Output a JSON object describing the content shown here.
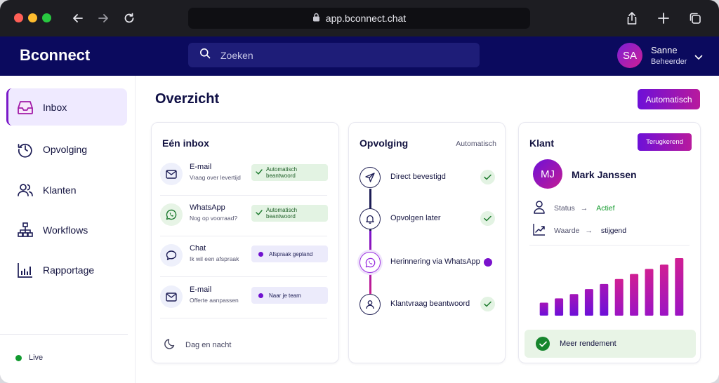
{
  "browser": {
    "url": "app.bconnect.chat"
  },
  "app": {
    "brand": "Bconnect",
    "search_placeholder": "Zoeken",
    "user": {
      "initials": "SA",
      "name": "Sanne",
      "role": "Beheerder"
    }
  },
  "sidebar": {
    "items": [
      {
        "label": "Inbox",
        "icon": "inbox-icon",
        "active": true
      },
      {
        "label": "Opvolging",
        "icon": "clock-icon",
        "active": false
      },
      {
        "label": "Klanten",
        "icon": "users-icon",
        "active": false
      },
      {
        "label": "Workflows",
        "icon": "workflow-icon",
        "active": false
      },
      {
        "label": "Rapportage",
        "icon": "bar-chart-icon",
        "active": false
      }
    ],
    "status": "Live"
  },
  "main": {
    "title": "Overzicht",
    "auto_button": "Automatisch"
  },
  "inbox_card": {
    "title": "Eén inbox",
    "rows": [
      {
        "channel": "E-mail",
        "message": "Vraag over levertijd",
        "status": "Automatisch beantwoord",
        "status_type": "green",
        "icon": "mail-icon"
      },
      {
        "channel": "WhatsApp",
        "message": "Nog op voorraad?",
        "status": "Automatisch beantwoord",
        "status_type": "green",
        "icon": "whatsapp-icon"
      },
      {
        "channel": "Chat",
        "message": "Ik wil een afspraak",
        "status": "Afspraak gepland",
        "status_type": "purple",
        "icon": "chat-icon"
      },
      {
        "channel": "E-mail",
        "message": "Offerte aanpassen",
        "status": "Naar je team",
        "status_type": "purple",
        "icon": "mail-icon"
      }
    ],
    "footer": "Dag en nacht"
  },
  "followup_card": {
    "title": "Opvolging",
    "mode": "Automatisch",
    "steps": [
      {
        "label": "Direct bevestigd",
        "icon": "send-icon",
        "state": "done"
      },
      {
        "label": "Opvolgen later",
        "icon": "bell-icon",
        "state": "done"
      },
      {
        "label": "Herinnering via WhatsApp",
        "icon": "whatsapp-icon",
        "state": "active"
      },
      {
        "label": "Klantvraag beantwoord",
        "icon": "user-icon",
        "state": "done"
      }
    ]
  },
  "customer_card": {
    "title": "Klant",
    "badge": "Terugkerend",
    "initials": "MJ",
    "name": "Mark Janssen",
    "status_label": "Status",
    "status_value": "Actief",
    "value_label": "Waarde",
    "value_value": "stijgend",
    "footer": "Meer rendement",
    "colors": {
      "status": "#129a2c",
      "accent_start": "#6d10d8",
      "accent_end": "#d01f93"
    }
  },
  "chart_data": {
    "type": "bar",
    "categories": [
      "1",
      "2",
      "3",
      "4",
      "5",
      "6",
      "7",
      "8",
      "9",
      "10"
    ],
    "values": [
      18,
      24,
      30,
      37,
      44,
      51,
      58,
      65,
      71,
      80
    ],
    "ylim": [
      0,
      80
    ],
    "grid": false,
    "axes_visible": false
  }
}
